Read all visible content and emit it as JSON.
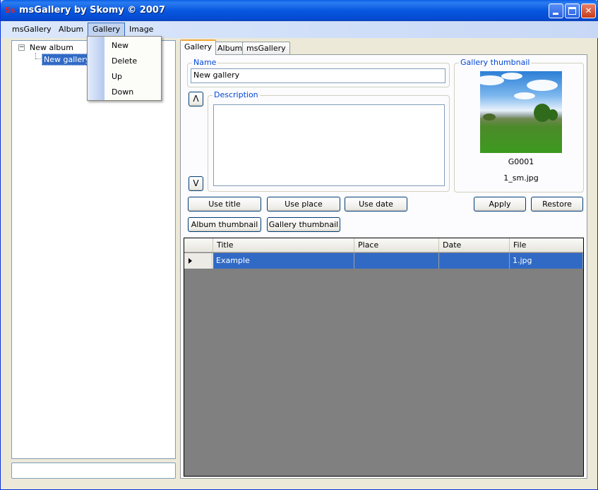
{
  "window": {
    "title": "msGallery by Skomy © 2007",
    "icon": "app-logo-icon",
    "controls": [
      "minimize-icon",
      "maximize-icon",
      "close-icon"
    ]
  },
  "menubar": {
    "items": [
      "msGallery",
      "Album",
      "Gallery",
      "Image"
    ],
    "open_index": 2
  },
  "gallery_menu": {
    "items": [
      "New",
      "Delete",
      "Up",
      "Down"
    ]
  },
  "tree": {
    "album": "New album",
    "gallery": "New gallery",
    "toggle": "−"
  },
  "tabs": [
    "Gallery",
    "Album",
    "msGallery"
  ],
  "form": {
    "name_label": "Name",
    "name_value": "New gallery",
    "description_label": "Description",
    "description_value": "",
    "up_button": "Λ",
    "down_button": "V",
    "thumbnail_label": "Gallery thumbnail",
    "thumbnail_id": "G0001",
    "thumbnail_file": "1_sm.jpg"
  },
  "buttons": {
    "use_title": "Use title",
    "use_place": "Use place",
    "use_date": "Use date",
    "apply": "Apply",
    "restore": "Restore",
    "album_thumbnail": "Album thumbnail",
    "gallery_thumbnail": "Gallery thumbnail"
  },
  "grid": {
    "columns": [
      "Title",
      "Place",
      "Date",
      "File"
    ],
    "rows": [
      {
        "title": "Example",
        "place": "",
        "date": "",
        "file": "1.jpg"
      }
    ]
  },
  "colors": {
    "titlebar": "#0858e0",
    "selection": "#316ac5",
    "group_label": "#0046d5"
  }
}
